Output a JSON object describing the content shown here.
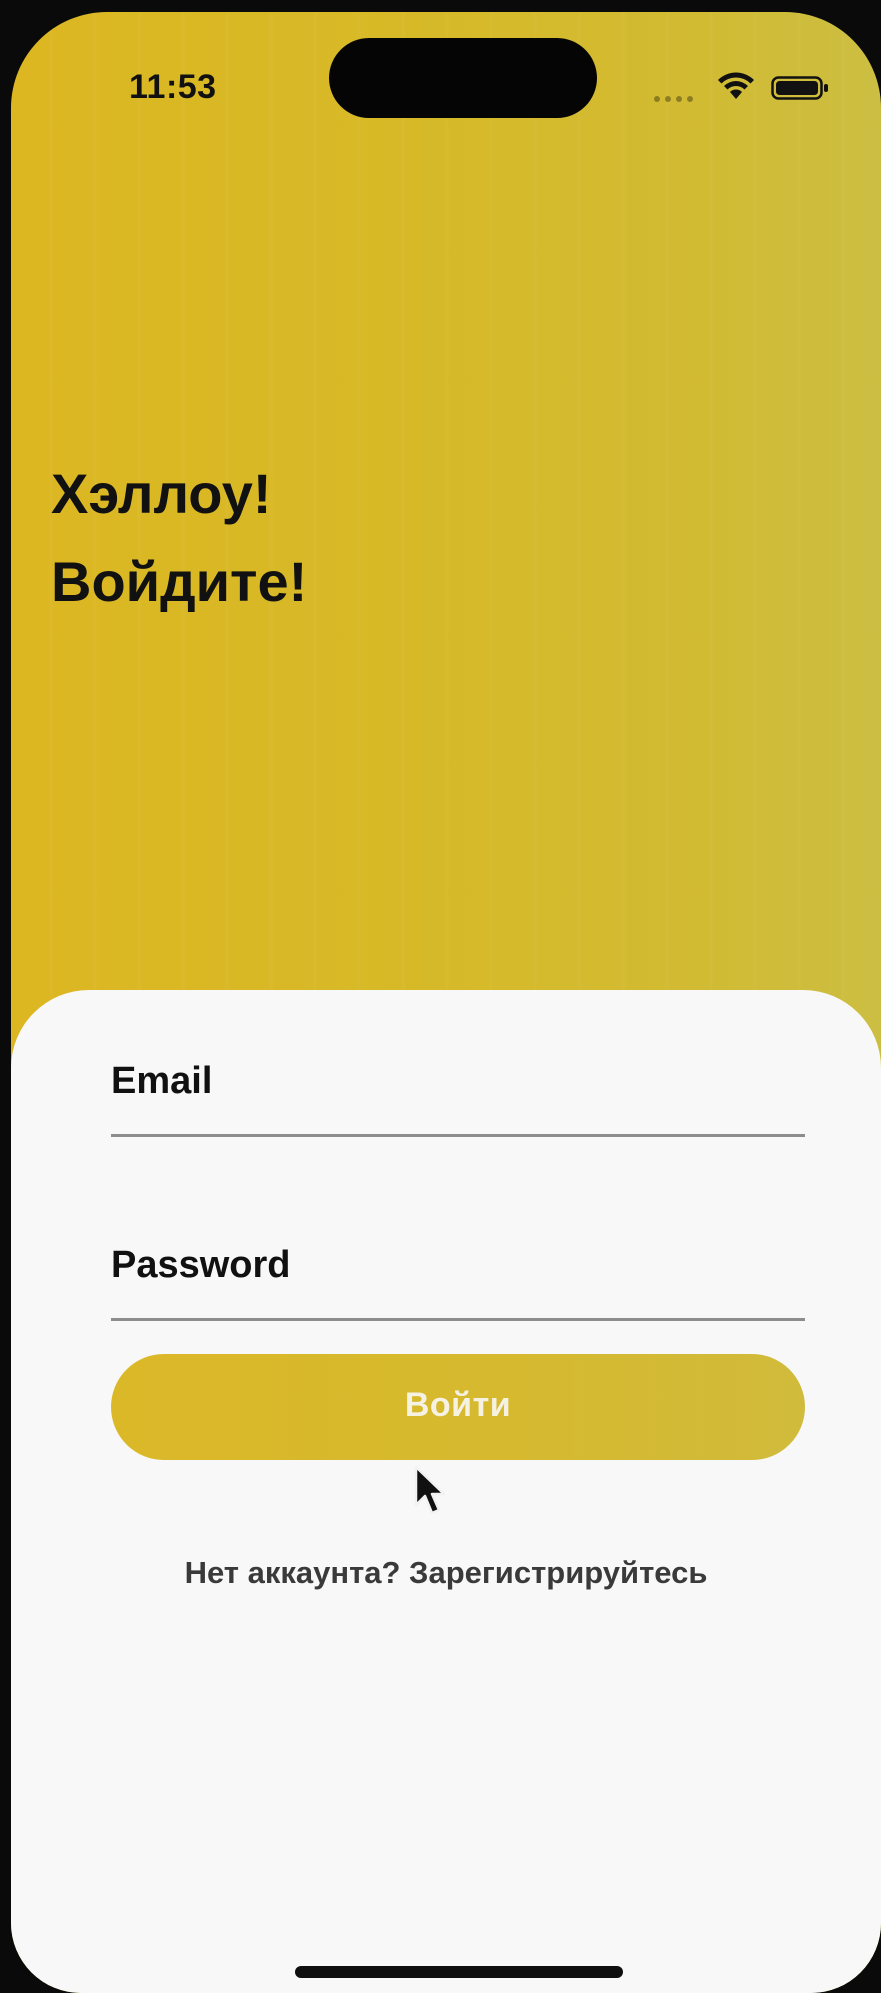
{
  "status_bar": {
    "time": "11:53",
    "wifi_icon": "wifi-icon",
    "battery_icon": "battery-icon",
    "signal_icon": "cellular-signal-icon"
  },
  "hero": {
    "line1": "Хэллоу!",
    "line2": "Войдите!"
  },
  "form": {
    "email_label": "Email",
    "email_value": "",
    "password_label": "Password",
    "password_value": "",
    "submit_label": "Войти",
    "register_text": "Нет аккаунта? Зарегистрируйтесь"
  },
  "colors": {
    "accent": "#d7b927",
    "card_background": "#f8f8f8",
    "text": "#111111"
  },
  "pointer_icon": "mouse-cursor-icon"
}
